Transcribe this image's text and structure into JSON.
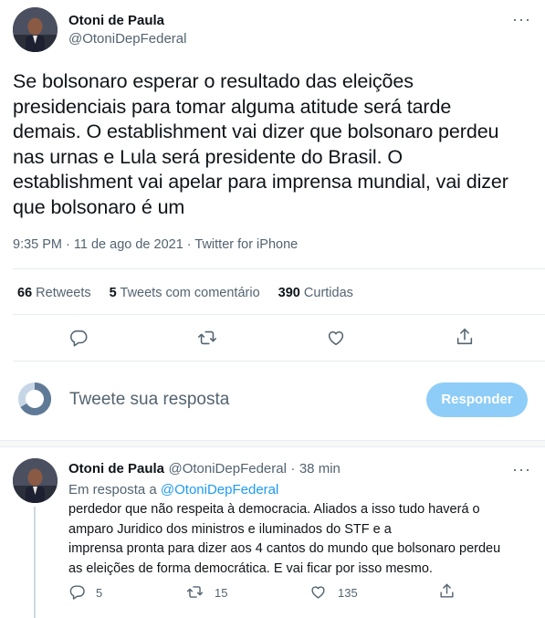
{
  "main_tweet": {
    "author_name": "Otoni de Paula",
    "author_handle": "@OtoniDepFederal",
    "text": "Se bolsonaro esperar o resultado das eleições presidenciais para tomar alguma atitude será tarde demais. O establishment vai dizer que bolsonaro perdeu nas urnas e Lula será presidente do Brasil. O establishment vai apelar para imprensa mundial, vai dizer que bolsonaro é um",
    "text_lines": [
      "Se bolsonaro esperar o resultado das eleições",
      "presidenciais para tomar alguma atitude será tarde",
      "demais. O establishment vai dizer que bolsonaro perdeu",
      "nas urnas e Lula será presidente do Brasil. O",
      "establishment vai apelar para imprensa mundial, vai dizer",
      "que bolsonaro é um"
    ],
    "timestamp": "9:35 PM · 11 de ago de 2021 · Twitter for iPhone",
    "retweets_count": "66",
    "retweets_label": "Retweets",
    "comments_count": "5",
    "comments_label": "Tweets com comentário",
    "likes_count": "390",
    "likes_label": "Curtidas",
    "more_label": "···"
  },
  "composer": {
    "placeholder": "Tweete sua resposta",
    "button_label": "Responder"
  },
  "reply_tweet": {
    "author_name": "Otoni de Paula",
    "author_handle": "@OtoniDepFederal",
    "time_ago": "38 min",
    "separator": "·",
    "in_reply_prefix": "Em resposta a",
    "in_reply_handle": "@OtoniDepFederal",
    "text_lines": [
      "perdedor que não respeita à democracia. Aliados a isso tudo haverá o",
      "amparo Juridico dos ministros e iluminados do STF e a",
      "imprensa pronta para dizer aos 4 cantos do mundo que bolsonaro perdeu",
      "as eleições de forma democrática. E vai ficar por isso mesmo."
    ],
    "replies_count": "5",
    "retweets_count": "15",
    "likes_count": "135",
    "more_label": "···"
  },
  "colors": {
    "accent": "#1d9bf0",
    "button_disabled": "#8ecdf8",
    "secondary_text": "#536471",
    "divider": "#e6ecf0"
  },
  "icons": [
    "more-icon",
    "reply-icon",
    "retweet-icon",
    "like-icon",
    "share-icon",
    "loading-ring-icon"
  ]
}
